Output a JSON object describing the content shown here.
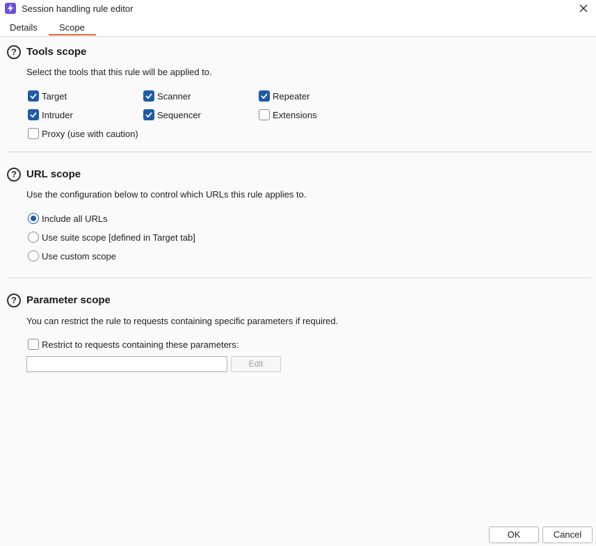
{
  "window": {
    "title": "Session handling rule editor"
  },
  "tabs": [
    "Details",
    "Scope"
  ],
  "tools_scope": {
    "heading": "Tools scope",
    "description": "Select the tools that this rule will be applied to.",
    "tools": [
      {
        "label": "Target",
        "checked": true
      },
      {
        "label": "Scanner",
        "checked": true
      },
      {
        "label": "Repeater",
        "checked": true
      },
      {
        "label": "Intruder",
        "checked": true
      },
      {
        "label": "Sequencer",
        "checked": true
      },
      {
        "label": "Extensions",
        "checked": false
      },
      {
        "label": "Proxy (use with caution)",
        "checked": false
      }
    ]
  },
  "url_scope": {
    "heading": "URL scope",
    "description": "Use the configuration below to control which URLs this rule applies to.",
    "options": [
      {
        "label": "Include all URLs",
        "selected": true
      },
      {
        "label": "Use suite scope [defined in Target tab]",
        "selected": false
      },
      {
        "label": "Use custom scope",
        "selected": false
      }
    ]
  },
  "parameter_scope": {
    "heading": "Parameter scope",
    "description": "You can restrict the rule to requests containing specific parameters if required.",
    "restrict_label": "Restrict to requests containing these parameters:",
    "restrict_checked": false,
    "input_value": "",
    "edit_label": "Edit"
  },
  "buttons": {
    "ok": "OK",
    "cancel": "Cancel"
  },
  "colors": {
    "accent": "#e8622e",
    "checkbox": "#1f5aa8",
    "app_icon": "#6c4ee0"
  }
}
